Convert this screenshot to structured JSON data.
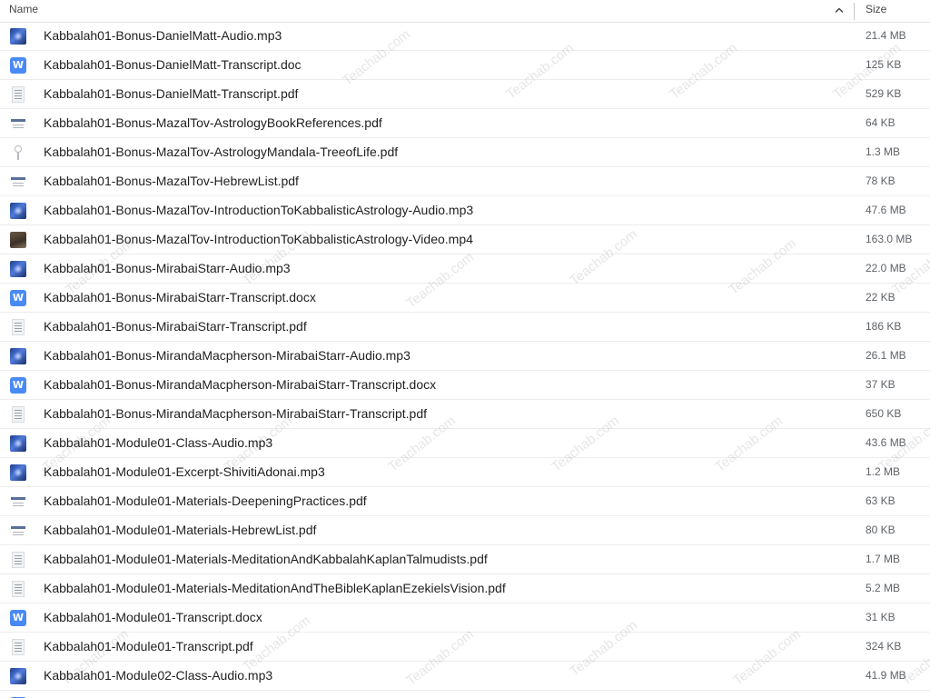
{
  "header": {
    "name_label": "Name",
    "size_label": "Size",
    "sort_icon": "chevron-up-icon"
  },
  "watermark_text": "Teachab.com",
  "files": [
    {
      "name": "Kabbalah01-Bonus-DanielMatt-Audio.mp3",
      "size": "21.4 MB",
      "icon": "audio"
    },
    {
      "name": "Kabbalah01-Bonus-DanielMatt-Transcript.doc",
      "size": "125 KB",
      "icon": "word"
    },
    {
      "name": "Kabbalah01-Bonus-DanielMatt-Transcript.pdf",
      "size": "529 KB",
      "icon": "pdf-a"
    },
    {
      "name": "Kabbalah01-Bonus-MazalTov-AstrologyBookReferences.pdf",
      "size": "64 KB",
      "icon": "pdf-b"
    },
    {
      "name": "Kabbalah01-Bonus-MazalTov-AstrologyMandala-TreeofLife.pdf",
      "size": "1.3 MB",
      "icon": "pdf-c"
    },
    {
      "name": "Kabbalah01-Bonus-MazalTov-HebrewList.pdf",
      "size": "78 KB",
      "icon": "pdf-b"
    },
    {
      "name": "Kabbalah01-Bonus-MazalTov-IntroductionToKabbalisticAstrology-Audio.mp3",
      "size": "47.6 MB",
      "icon": "audio"
    },
    {
      "name": "Kabbalah01-Bonus-MazalTov-IntroductionToKabbalisticAstrology-Video.mp4",
      "size": "163.0 MB",
      "icon": "video"
    },
    {
      "name": "Kabbalah01-Bonus-MirabaiStarr-Audio.mp3",
      "size": "22.0 MB",
      "icon": "audio"
    },
    {
      "name": "Kabbalah01-Bonus-MirabaiStarr-Transcript.docx",
      "size": "22 KB",
      "icon": "word"
    },
    {
      "name": "Kabbalah01-Bonus-MirabaiStarr-Transcript.pdf",
      "size": "186 KB",
      "icon": "pdf-a"
    },
    {
      "name": "Kabbalah01-Bonus-MirandaMacpherson-MirabaiStarr-Audio.mp3",
      "size": "26.1 MB",
      "icon": "audio"
    },
    {
      "name": "Kabbalah01-Bonus-MirandaMacpherson-MirabaiStarr-Transcript.docx",
      "size": "37 KB",
      "icon": "word"
    },
    {
      "name": "Kabbalah01-Bonus-MirandaMacpherson-MirabaiStarr-Transcript.pdf",
      "size": "650 KB",
      "icon": "pdf-a"
    },
    {
      "name": "Kabbalah01-Module01-Class-Audio.mp3",
      "size": "43.6 MB",
      "icon": "audio"
    },
    {
      "name": "Kabbalah01-Module01-Excerpt-ShivitiAdonai.mp3",
      "size": "1.2 MB",
      "icon": "audio"
    },
    {
      "name": "Kabbalah01-Module01-Materials-DeepeningPractices.pdf",
      "size": "63 KB",
      "icon": "pdf-b"
    },
    {
      "name": "Kabbalah01-Module01-Materials-HebrewList.pdf",
      "size": "80 KB",
      "icon": "pdf-b"
    },
    {
      "name": "Kabbalah01-Module01-Materials-MeditationAndKabbalahKaplanTalmudists.pdf",
      "size": "1.7 MB",
      "icon": "pdf-a"
    },
    {
      "name": "Kabbalah01-Module01-Materials-MeditationAndTheBibleKaplanEzekielsVision.pdf",
      "size": "5.2 MB",
      "icon": "pdf-a"
    },
    {
      "name": "Kabbalah01-Module01-Transcript.docx",
      "size": "31 KB",
      "icon": "word"
    },
    {
      "name": "Kabbalah01-Module01-Transcript.pdf",
      "size": "324 KB",
      "icon": "pdf-a"
    },
    {
      "name": "Kabbalah01-Module02-Class-Audio.mp3",
      "size": "41.9 MB",
      "icon": "audio"
    },
    {
      "name": "",
      "size": "",
      "icon": "word"
    }
  ]
}
